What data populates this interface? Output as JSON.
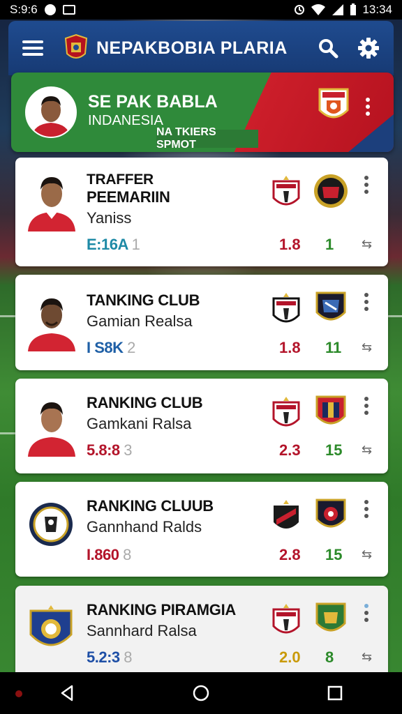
{
  "status_bar": {
    "left_text": "S:9:6",
    "time": "13:34"
  },
  "app_bar": {
    "title": "NEPAKBOBIA PLARIA",
    "icons": [
      "menu-icon",
      "app-logo-crest",
      "search-icon",
      "gear-icon"
    ]
  },
  "banner": {
    "title": "SE PAK BABLA",
    "subtitle": "INDANESIA",
    "pill_label": "NA TKIERS SPMOT"
  },
  "cards": [
    {
      "title": "TRAFFER",
      "title2": "PEEMARIIN",
      "subtitle": "Yaniss",
      "code": "E:16A",
      "code_suffix": "1",
      "code_color": "#1e8aa6",
      "value1": "1.8",
      "value1_color": "#b3142a",
      "value2": "1"
    },
    {
      "title": "TANKING CLUB",
      "subtitle": "Gamian Realsa",
      "code": "I S8K",
      "code_suffix": "2",
      "code_color": "#1e5fa6",
      "value1": "1.8",
      "value1_color": "#b3142a",
      "value2": "11"
    },
    {
      "title": "RANKING CLUB",
      "subtitle": "Gamkani Ralsa",
      "code": "5.8:8",
      "code_suffix": "3",
      "code_color": "#b3142a",
      "value1": "2.3",
      "value1_color": "#b3142a",
      "value2": "15"
    },
    {
      "title": "RANKING CLUUB",
      "subtitle": "Gannhand Ralds",
      "code": "I.860",
      "code_suffix": "8",
      "code_color": "#b3142a",
      "value1": "2.8",
      "value1_color": "#b3142a",
      "value2": "15"
    },
    {
      "title": "RANKING PIRAMGIA",
      "subtitle": "Sannhard Ralsa",
      "code": "5.2:3",
      "code_suffix": "8",
      "code_color": "#1e4fa6",
      "value1": "2.0",
      "value1_color": "#c99a0a",
      "value2": "8"
    }
  ],
  "colors": {
    "app_bar": "#1f4b8f",
    "banner_green": "#2f8a3a",
    "banner_red": "#cc1e2a",
    "value2_green": "#2c8a2a"
  }
}
